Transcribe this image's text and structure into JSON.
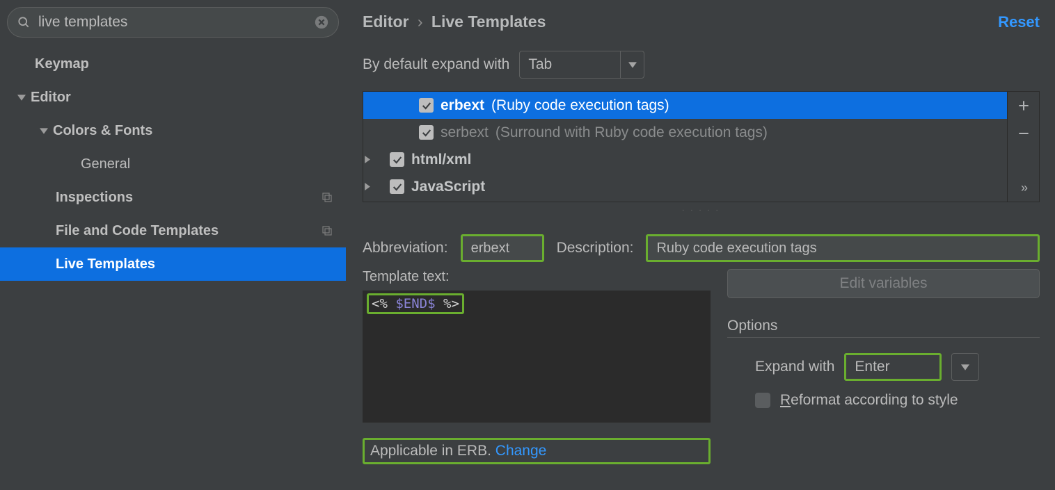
{
  "search": {
    "value": "live templates"
  },
  "sidebar": {
    "items": [
      {
        "label": "Keymap",
        "depth": 1,
        "expandable": false,
        "selected": false,
        "badge": false
      },
      {
        "label": "Editor",
        "depth": 1,
        "expandable": true,
        "expanded": true,
        "selected": false,
        "badge": false
      },
      {
        "label": "Colors & Fonts",
        "depth": 2,
        "expandable": true,
        "expanded": true,
        "selected": false,
        "badge": false
      },
      {
        "label": "General",
        "depth": 3,
        "expandable": false,
        "selected": false,
        "badge": false
      },
      {
        "label": "Inspections",
        "depth": 2,
        "expandable": false,
        "selected": false,
        "badge": true
      },
      {
        "label": "File and Code Templates",
        "depth": 2,
        "expandable": false,
        "selected": false,
        "badge": true
      },
      {
        "label": "Live Templates",
        "depth": 2,
        "expandable": false,
        "selected": true,
        "badge": false
      }
    ]
  },
  "breadcrumb": {
    "parent": "Editor",
    "current": "Live Templates"
  },
  "reset": "Reset",
  "expand_with": {
    "label": "By default expand with",
    "value": "Tab"
  },
  "templates": {
    "items": [
      {
        "type": "item",
        "name": "erbext",
        "desc": "(Ruby code execution tags)",
        "checked": true,
        "selected": true
      },
      {
        "type": "item",
        "name": "serbext",
        "desc": "(Surround with Ruby code execution tags)",
        "checked": true,
        "selected": false
      },
      {
        "type": "group",
        "name": "html/xml",
        "checked": true
      },
      {
        "type": "group",
        "name": "JavaScript",
        "checked": true
      }
    ]
  },
  "editor": {
    "abbrev_label": "Abbreviation:",
    "abbrev_value": "erbext",
    "desc_label": "Description:",
    "desc_value": "Ruby code execution tags",
    "tpl_text_label": "Template text:",
    "tpl_open": "<%",
    "tpl_var": "$END$",
    "tpl_close": "%>",
    "edit_vars": "Edit variables"
  },
  "options": {
    "title": "Options",
    "expand_label": "Expand with",
    "expand_value": "Enter",
    "reformat_label": "eformat according to style",
    "reformat_prefix": "R"
  },
  "applicable": {
    "text": "Applicable in ERB.",
    "change": "Change"
  }
}
